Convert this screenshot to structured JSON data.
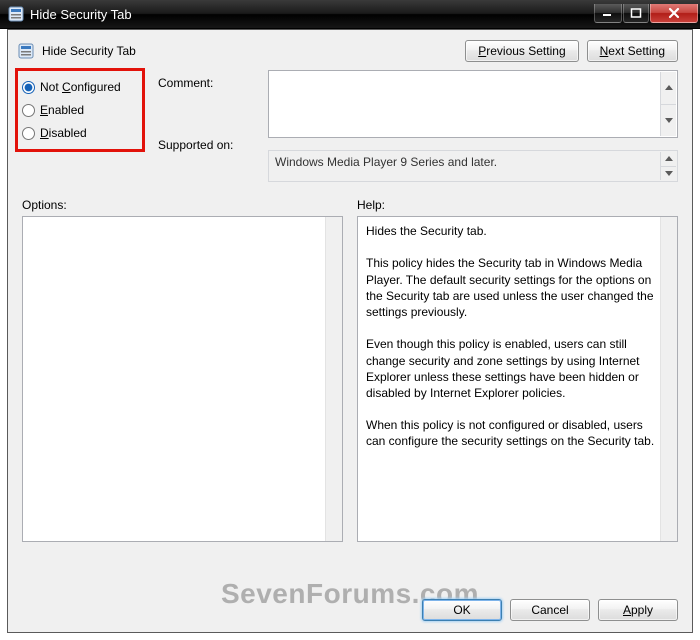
{
  "titlebar": {
    "title": "Hide Security Tab"
  },
  "header": {
    "title": "Hide Security Tab",
    "prev_btn": "Previous Setting",
    "prev_access": "P",
    "next_btn": "Next Setting",
    "next_access": "N"
  },
  "state": {
    "not_configured": "Not Configured",
    "not_configured_access": "C",
    "enabled": "Enabled",
    "enabled_access": "E",
    "disabled": "Disabled",
    "disabled_access": "D",
    "selected": "not_configured"
  },
  "labels": {
    "comment": "Comment:",
    "supported": "Supported on:",
    "options": "Options:",
    "help": "Help:"
  },
  "supported_text": "Windows Media Player 9 Series and later.",
  "help_text": {
    "p1": "Hides the Security tab.",
    "p2": "This policy hides the Security tab in Windows Media Player. The default security settings for the options on the Security tab are used unless the user changed the settings previously.",
    "p3": "Even though this policy is enabled, users can still change security and zone settings by using Internet Explorer unless these settings have been hidden or disabled by Internet Explorer policies.",
    "p4": "When this policy is not configured or disabled, users can configure the security settings on the Security tab."
  },
  "footer": {
    "ok": "OK",
    "cancel": "Cancel",
    "apply": "Apply",
    "apply_access": "A"
  },
  "watermark": "SevenForums.com"
}
